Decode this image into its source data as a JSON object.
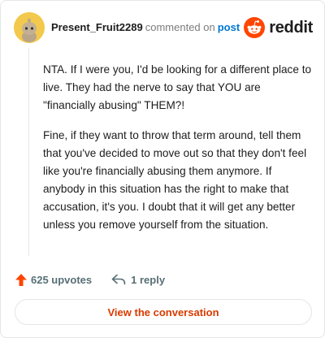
{
  "comment": {
    "username": "Present_Fruit2289",
    "action_text": "commented on",
    "post_link_text": "post",
    "paragraphs": [
      "NTA. If I were you, I'd be looking for a different place to live. They had the nerve to say that YOU are \"financially abusing\" THEM?!",
      "Fine, if they want to throw that term around, tell them that you've decided to move out so that they don't feel like you're financially abusing them anymore. If anybody in this situation has the right to make that accusation, it's you. I doubt that it will get any better unless you remove yourself from the situation."
    ]
  },
  "brand": {
    "name": "reddit",
    "color": "#ff4500",
    "icon": "reddit-snoo-icon"
  },
  "actions": {
    "upvotes": "625 upvotes",
    "replies": "1 reply",
    "upvote_icon": "upvote-arrow-icon",
    "reply_icon": "reply-arrow-icon",
    "upvote_color": "#ff4500"
  },
  "view_button": {
    "label": "View the conversation",
    "color": "#d93a00"
  }
}
